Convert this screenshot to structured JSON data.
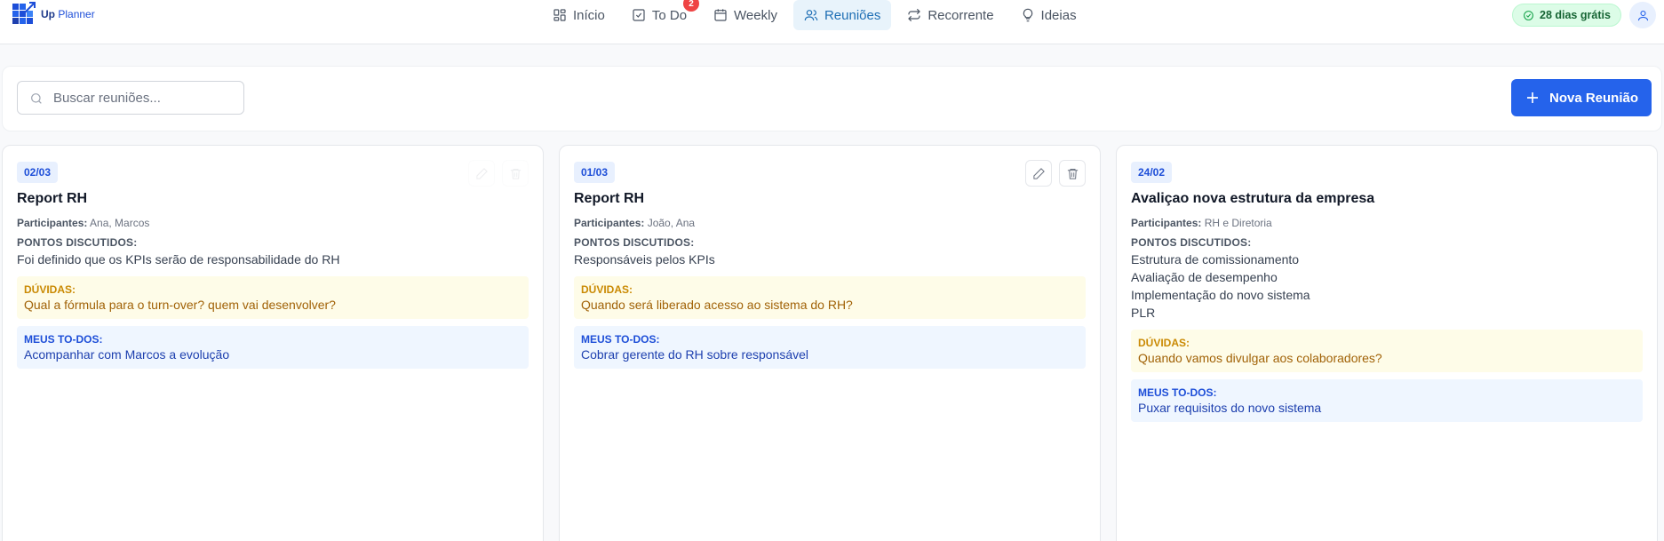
{
  "app": {
    "logo_bold": "Up",
    "logo_light": "Planner"
  },
  "nav": {
    "items": [
      {
        "label": "Início",
        "icon": "grid-icon",
        "active": false
      },
      {
        "label": "To Do",
        "icon": "checkbox-icon",
        "active": false,
        "badge": "2"
      },
      {
        "label": "Weekly",
        "icon": "calendar-icon",
        "active": false
      },
      {
        "label": "Reuniões",
        "icon": "users-icon",
        "active": true
      },
      {
        "label": "Recorrente",
        "icon": "repeat-icon",
        "active": false
      },
      {
        "label": "Ideias",
        "icon": "lightbulb-icon",
        "active": false
      }
    ]
  },
  "trial": {
    "label": "28 dias grátis"
  },
  "toolbar": {
    "search_placeholder": "Buscar reuniões...",
    "new_button_label": "Nova Reunião"
  },
  "labels": {
    "participants": "Participantes:",
    "points": "PONTOS DISCUTIDOS:",
    "doubts": "DÚVIDAS:",
    "todos": "MEUS TO-DOS:"
  },
  "colors": {
    "accent": "#2563eb",
    "active_nav_bg": "#e8f3fb",
    "doubts_bg": "#fefce8",
    "todos_bg": "#eff6ff",
    "badge": "#ef4444"
  },
  "meetings": [
    {
      "date": "02/03",
      "title": "Report RH",
      "participants": "Ana, Marcos",
      "points": [
        "Foi definido que os KPIs serão de responsabilidade do RH"
      ],
      "doubts": "Qual a fórmula para o turn-over? quem vai desenvolver?",
      "todos": "Acompanhar com Marcos a evolução"
    },
    {
      "date": "01/03",
      "title": "Report RH",
      "participants": "João, Ana",
      "points": [
        "Responsáveis pelos KPIs"
      ],
      "doubts": "Quando será liberado acesso ao sistema do RH?",
      "todos": "Cobrar gerente do RH sobre responsável"
    },
    {
      "date": "24/02",
      "title": "Avaliçao nova estrutura da empresa",
      "participants": "RH e Diretoria",
      "points": [
        "Estrutura de comissionamento",
        "Avaliação de desempenho",
        "Implementação do novo sistema",
        "PLR"
      ],
      "doubts": "Quando vamos divulgar aos colaboradores?",
      "todos": "Puxar requisitos do novo sistema"
    }
  ]
}
